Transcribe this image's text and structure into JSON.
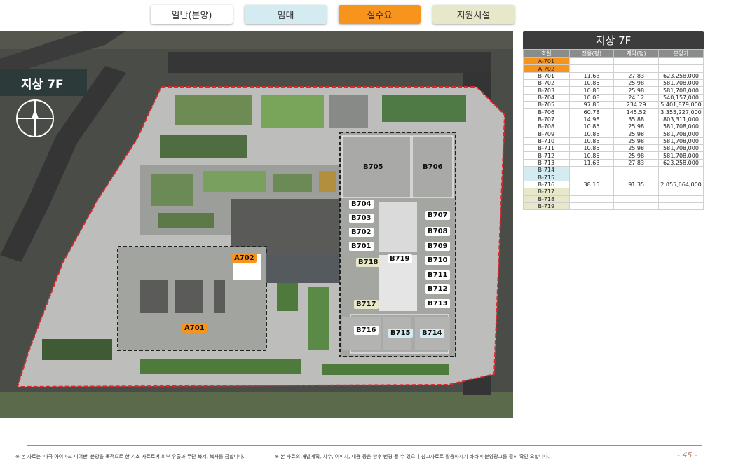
{
  "legend": [
    {
      "label": "일반(분양)",
      "color": "#ffffff"
    },
    {
      "label": "임대",
      "color": "#d4ebf2"
    },
    {
      "label": "실수요",
      "color": "#f7941d"
    },
    {
      "label": "지원시설",
      "color": "#e7e7c9"
    }
  ],
  "plan": {
    "floor_badge": "지상 7F",
    "compass": "N",
    "units": [
      {
        "id": "B705",
        "bg": "none"
      },
      {
        "id": "B706",
        "bg": "none"
      },
      {
        "id": "B704",
        "bg": "#ffffff"
      },
      {
        "id": "B703",
        "bg": "#ffffff"
      },
      {
        "id": "B702",
        "bg": "#ffffff"
      },
      {
        "id": "B701",
        "bg": "#ffffff"
      },
      {
        "id": "B707",
        "bg": "#ffffff"
      },
      {
        "id": "B708",
        "bg": "#ffffff"
      },
      {
        "id": "B709",
        "bg": "#ffffff"
      },
      {
        "id": "B710",
        "bg": "#ffffff"
      },
      {
        "id": "B711",
        "bg": "#ffffff"
      },
      {
        "id": "B712",
        "bg": "#ffffff"
      },
      {
        "id": "B713",
        "bg": "#ffffff"
      },
      {
        "id": "B719",
        "bg": "#ffffff"
      },
      {
        "id": "B718",
        "bg": "#e7e7c9"
      },
      {
        "id": "B717",
        "bg": "#e7e7c9"
      },
      {
        "id": "B716",
        "bg": "#ffffff"
      },
      {
        "id": "B715",
        "bg": "#d4ebf2"
      },
      {
        "id": "B714",
        "bg": "#d4ebf2"
      },
      {
        "id": "A702",
        "bg": "#f7941d"
      },
      {
        "id": "A701",
        "bg": "#f7941d"
      }
    ]
  },
  "table": {
    "title": "지상 7F",
    "headers": [
      "호실",
      "전용(평)",
      "계약(평)",
      "분양가"
    ],
    "rows": [
      {
        "unit": "A-701",
        "excl": "",
        "contract": "",
        "price": "",
        "type": "demand"
      },
      {
        "unit": "A-702",
        "excl": "",
        "contract": "",
        "price": "",
        "type": "demand"
      },
      {
        "unit": "B-701",
        "excl": "11.63",
        "contract": "27.83",
        "price": "623,258,000",
        "type": "sale"
      },
      {
        "unit": "B-702",
        "excl": "10.85",
        "contract": "25.98",
        "price": "581,708,000",
        "type": "sale"
      },
      {
        "unit": "B-703",
        "excl": "10.85",
        "contract": "25.98",
        "price": "581,708,000",
        "type": "sale"
      },
      {
        "unit": "B-704",
        "excl": "10.08",
        "contract": "24.12",
        "price": "540,157,000",
        "type": "sale"
      },
      {
        "unit": "B-705",
        "excl": "97.85",
        "contract": "234.29",
        "price": "5,401,879,000",
        "type": "sale"
      },
      {
        "unit": "B-706",
        "excl": "60.78",
        "contract": "145.52",
        "price": "3,355,227,000",
        "type": "sale"
      },
      {
        "unit": "B-707",
        "excl": "14.98",
        "contract": "35.88",
        "price": "803,311,000",
        "type": "sale"
      },
      {
        "unit": "B-708",
        "excl": "10.85",
        "contract": "25.98",
        "price": "581,708,000",
        "type": "sale"
      },
      {
        "unit": "B-709",
        "excl": "10.85",
        "contract": "25.98",
        "price": "581,708,000",
        "type": "sale"
      },
      {
        "unit": "B-710",
        "excl": "10.85",
        "contract": "25.98",
        "price": "581,708,000",
        "type": "sale"
      },
      {
        "unit": "B-711",
        "excl": "10.85",
        "contract": "25.98",
        "price": "581,708,000",
        "type": "sale"
      },
      {
        "unit": "B-712",
        "excl": "10.85",
        "contract": "25.98",
        "price": "581,708,000",
        "type": "sale"
      },
      {
        "unit": "B-713",
        "excl": "11.63",
        "contract": "27.83",
        "price": "623,258,000",
        "type": "sale"
      },
      {
        "unit": "B-714",
        "excl": "",
        "contract": "",
        "price": "",
        "type": "rent"
      },
      {
        "unit": "B-715",
        "excl": "",
        "contract": "",
        "price": "",
        "type": "rent"
      },
      {
        "unit": "B-716",
        "excl": "38.15",
        "contract": "91.35",
        "price": "2,055,664,000",
        "type": "sale"
      },
      {
        "unit": "B-717",
        "excl": "",
        "contract": "",
        "price": "",
        "type": "support"
      },
      {
        "unit": "B-718",
        "excl": "",
        "contract": "",
        "price": "",
        "type": "support"
      },
      {
        "unit": "B-719",
        "excl": "",
        "contract": "",
        "price": "",
        "type": "support"
      }
    ],
    "type_colors": {
      "demand": "#f7941d",
      "sale": "#ffffff",
      "rent": "#d4ebf2",
      "support": "#e7e7c9"
    }
  },
  "footer": {
    "note_left": "※ 본 자료는 '마곡 아이파크 디어반' 분양을 목적으로 한 기초 자료로써 외부 유출과 무단 복제, 복사를 금합니다.",
    "note_right": "※ 본 자료의 개발계획, 치수, 이미지, 내용 등은 향후 변경 될 수 있으니 참고자료로 활용하시기 바라며 분양광고를 필히 확인 요합니다.",
    "page": "- 45 -"
  }
}
